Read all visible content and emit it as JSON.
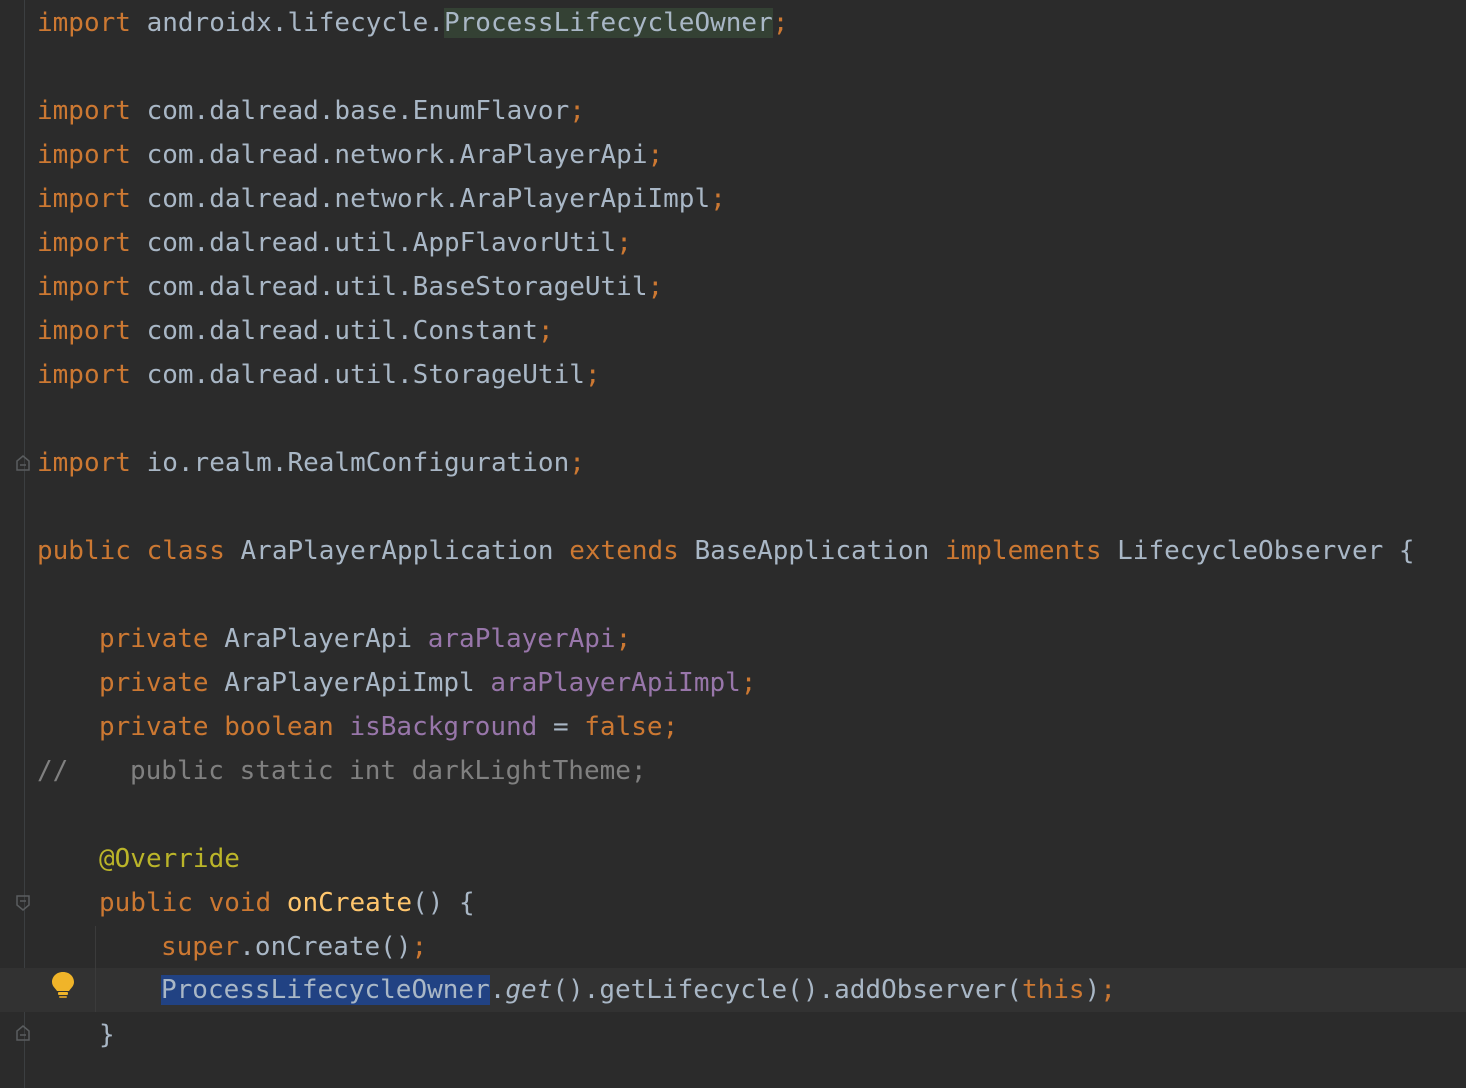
{
  "editor": {
    "lines": {
      "l1": {
        "kw": "import",
        "pkg": "androidx.lifecycle.",
        "cls": "ProcessLifecycleOwner",
        "semi": ";"
      },
      "l3": {
        "kw": "import",
        "text": "com.dalread.base.EnumFlavor",
        "semi": ";"
      },
      "l4": {
        "kw": "import",
        "text": "com.dalread.network.AraPlayerApi",
        "semi": ";"
      },
      "l5": {
        "kw": "import",
        "text": "com.dalread.network.AraPlayerApiImpl",
        "semi": ";"
      },
      "l6": {
        "kw": "import",
        "text": "com.dalread.util.AppFlavorUtil",
        "semi": ";"
      },
      "l7": {
        "kw": "import",
        "text": "com.dalread.util.BaseStorageUtil",
        "semi": ";"
      },
      "l8": {
        "kw": "import",
        "text": "com.dalread.util.Constant",
        "semi": ";"
      },
      "l9": {
        "kw": "import",
        "text": "com.dalread.util.StorageUtil",
        "semi": ";"
      },
      "l11": {
        "kw": "import",
        "text": "io.realm.RealmConfiguration",
        "semi": ";"
      },
      "l13": {
        "kw_public": "public",
        "kw_class": "class",
        "class_name": "AraPlayerApplication",
        "kw_extends": "extends",
        "base": "BaseApplication",
        "kw_implements": "implements",
        "iface": "LifecycleObserver",
        "brace": "{"
      },
      "l15": {
        "kw": "private",
        "type": "AraPlayerApi",
        "field": "araPlayerApi",
        "semi": ";"
      },
      "l16": {
        "kw": "private",
        "type": "AraPlayerApiImpl",
        "field": "araPlayerApiImpl",
        "semi": ";"
      },
      "l17": {
        "kw": "private",
        "type_kw": "boolean",
        "field": "isBackground",
        "eq": "=",
        "val": "false",
        "semi": ";"
      },
      "l18": {
        "comment_marker": "//",
        "comment_text": "public static int darkLightTheme;"
      },
      "l20": {
        "annotation": "@Override"
      },
      "l21": {
        "kw_public": "public",
        "kw_void": "void",
        "method": "onCreate",
        "rest": "() {"
      },
      "l22": {
        "kw_super": "super",
        "call": ".onCreate()",
        "semi": ";"
      },
      "l23": {
        "cls": "ProcessLifecycleOwner",
        "dot": ".",
        "static_call": "get",
        "chain": "().getLifecycle().addObserver(",
        "kw_this": "this",
        "close": ")",
        "semi": ";"
      },
      "l24": {
        "brace": "}"
      }
    },
    "colors": {
      "background": "#2b2b2b",
      "keyword": "#cc7832",
      "text": "#a9b7c6",
      "field": "#9876aa",
      "annotation": "#bbb529",
      "method": "#ffc66d",
      "comment": "#808080",
      "selection": "#214283"
    },
    "icons": {
      "intention_bulb": "lightbulb-icon",
      "fold_markers": "fold-icon"
    }
  }
}
